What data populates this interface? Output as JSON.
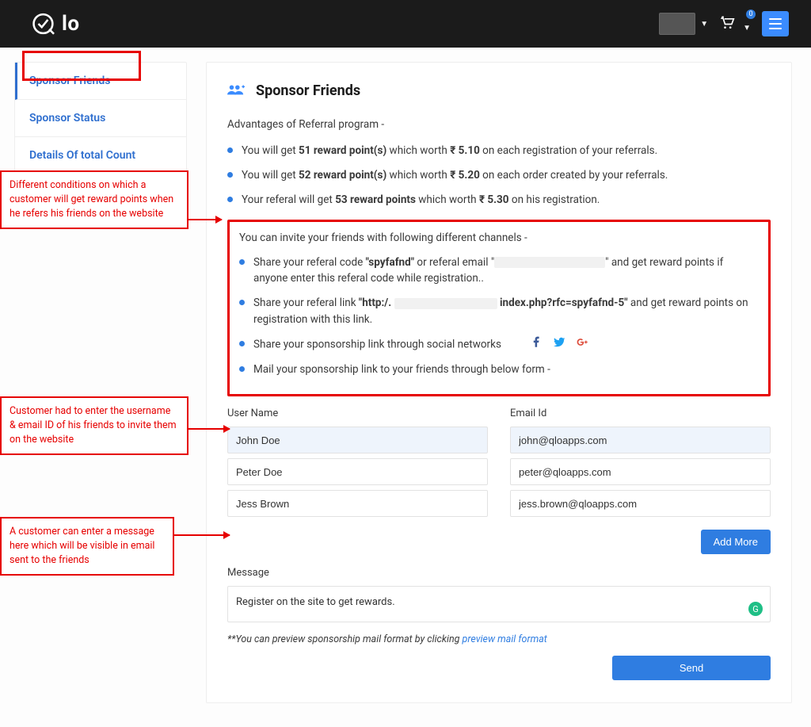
{
  "topbar": {
    "cart_badge": "0"
  },
  "sidebar": {
    "items": [
      {
        "label": "Sponsor Friends"
      },
      {
        "label": "Sponsor Status"
      },
      {
        "label": "Details Of total Count"
      }
    ]
  },
  "page": {
    "title": "Sponsor Friends",
    "adv_title": "Advantages of Referral program -",
    "adv": [
      {
        "pre": "You will get ",
        "b1": "51 reward point(s)",
        "mid": " which worth ",
        "b2": "₹ 5.10",
        "post": " on each registration of your referrals."
      },
      {
        "pre": "You will get ",
        "b1": "52 reward point(s)",
        "mid": " which worth ",
        "b2": "₹ 5.20",
        "post": " on each order created by your referrals."
      },
      {
        "pre": "Your referal will get ",
        "b1": "53 reward points",
        "mid": " which worth ",
        "b2": "₹ 5.30",
        "post": " on his registration."
      }
    ],
    "channels_title": "You can invite your friends with following different channels -",
    "ch1_pre": "Share your referal code ",
    "ch1_code": "\"spyfafnd\"",
    "ch1_mid": " or referal email \"",
    "ch1_end": "\" and get reward points if anyone enter this referal code while registration..",
    "ch2_pre": "Share your referal link ",
    "ch2_l1": "\"http:/.",
    "ch2_l2": "index.php?rfc=spyfafnd-5\"",
    "ch2_end": " and get reward points on registration with this link.",
    "ch3": "Share your sponsorship link through social networks",
    "ch4": "Mail your sponsorship link to your friends through below form -",
    "form": {
      "user_label": "User Name",
      "email_label": "Email Id",
      "rows": [
        {
          "name": "John Doe",
          "email": "john@qloapps.com"
        },
        {
          "name": "Peter Doe",
          "email": "peter@qloapps.com"
        },
        {
          "name": "Jess Brown",
          "email": "jess.brown@qloapps.com"
        }
      ],
      "add_more": "Add More",
      "msg_label": "Message",
      "msg_value": "Register on the site to get rewards.",
      "preview_pre": "**You can preview sponsorship mail format by clicking ",
      "preview_link": "preview mail format",
      "send": "Send"
    }
  },
  "annotations": {
    "a1": "Different conditions on which a customer will get reward points when he refers his friends on the website",
    "a2": "Customer had to enter the username & email ID of his friends to invite them on the website",
    "a3": "A customer can enter a message here which will be visible in email sent to the friends"
  },
  "colors": {
    "accent": "#2f7de1",
    "danger": "#e60000"
  }
}
